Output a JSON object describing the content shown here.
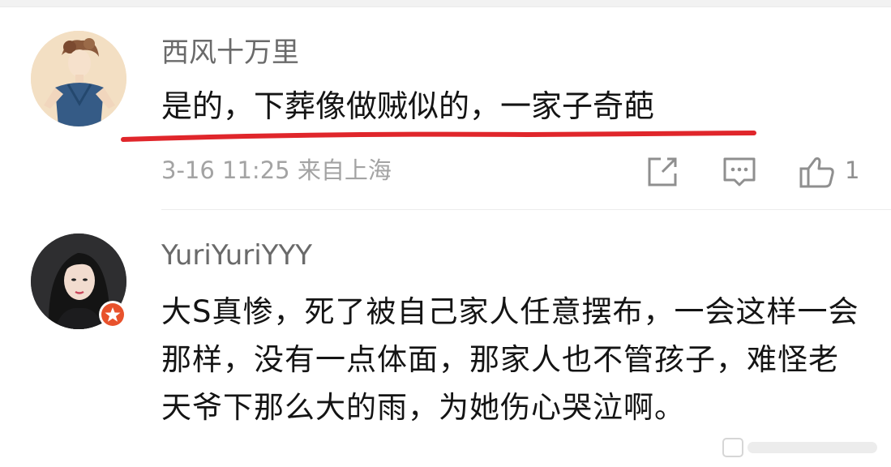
{
  "comments": [
    {
      "username": "西风十万里",
      "text": "是的，下葬像做贼似的，一家子奇葩",
      "date": "3-16",
      "time": "11:25",
      "location": "来自上海",
      "likes": "1",
      "meta": "3-16 11:25 来自上海"
    },
    {
      "username": "YuriYuriYYY",
      "text": "大S真惨，死了被自己家人任意摆布，一会这样一会那样，没有一点体面，那家人也不管孩子，难怪老天爷下那么大的雨，为她伤心哭泣啊。"
    }
  ],
  "icons": {
    "share": "share-icon",
    "reply": "comment-icon",
    "like": "thumbs-up-icon",
    "verified": "verified-badge-icon"
  },
  "colors": {
    "underline": "#e0262b",
    "username": "#6a6a6a",
    "meta": "#a3a3a3",
    "badge": "#e8522c"
  }
}
